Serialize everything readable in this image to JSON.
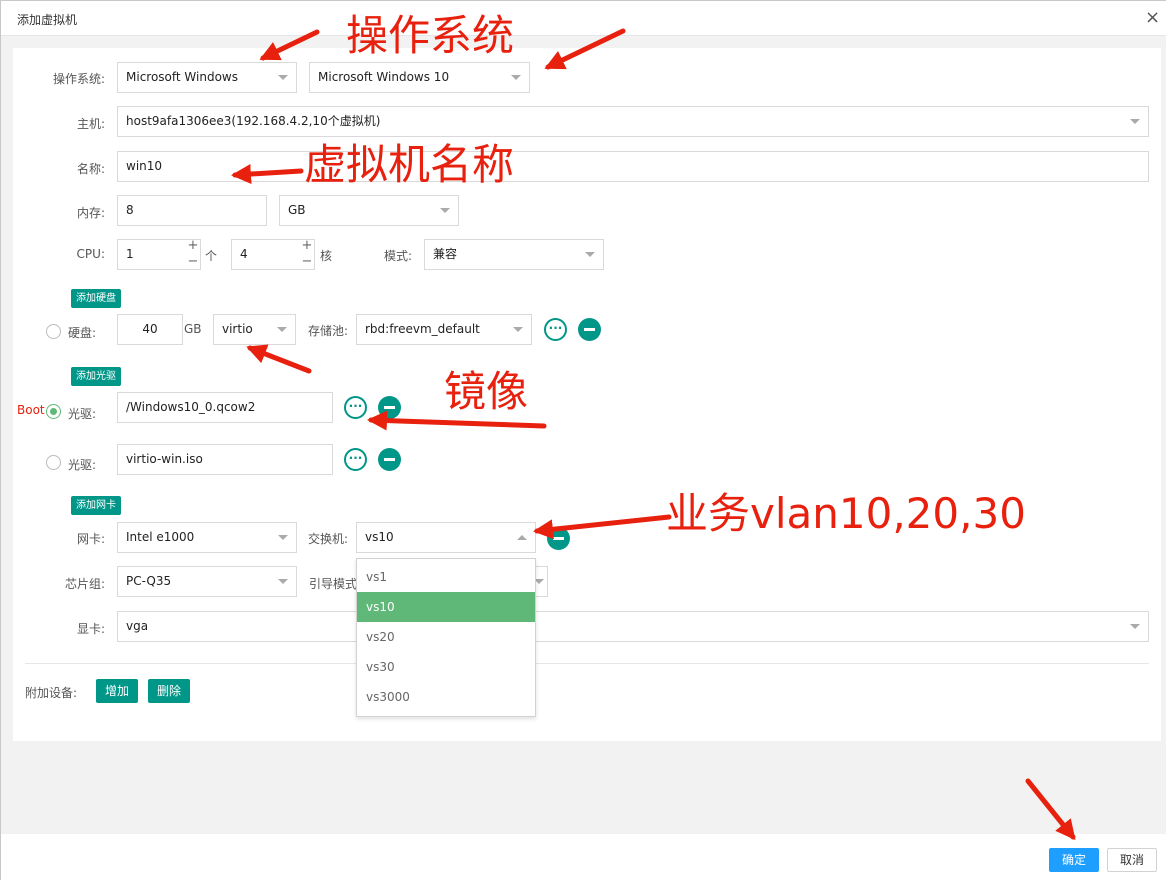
{
  "dialog": {
    "title": "添加虚拟机",
    "close_glyph": "×"
  },
  "form": {
    "os": {
      "label": "操作系统:",
      "family": "Microsoft Windows",
      "version": "Microsoft Windows 10"
    },
    "host": {
      "label": "主机:",
      "value": "host9afa1306ee3(192.168.4.2,10个虚拟机)"
    },
    "name": {
      "label": "名称:",
      "value": "win10"
    },
    "memory": {
      "label": "内存:",
      "value": "8",
      "unit": "GB"
    },
    "cpu": {
      "label": "CPU:",
      "sockets": "1",
      "sockets_unit": "个",
      "cores": "4",
      "cores_unit": "核",
      "mode_label": "模式:",
      "mode": "兼容"
    },
    "add_disk": "添加硬盘",
    "disk": {
      "label": "硬盘:",
      "size": "40",
      "unit": "GB",
      "bus": "virtio",
      "pool_label": "存储池:",
      "pool": "rbd:freevm_default"
    },
    "add_cdrom": "添加光驱",
    "boot_tag": "Boot",
    "cdroms": [
      {
        "label": "光驱:",
        "value": "/Windows10_0.qcow2",
        "boot": true
      },
      {
        "label": "光驱:",
        "value": "virtio-win.iso",
        "boot": false
      }
    ],
    "add_nic": "添加网卡",
    "nic": {
      "label": "网卡:",
      "model": "Intel e1000",
      "switch_label": "交换机:",
      "switch": "vs10"
    },
    "chipset": {
      "label": "芯片组:",
      "value": "PC-Q35",
      "boot_mode_label": "引导模式"
    },
    "gpu": {
      "label": "显卡:",
      "value": "vga"
    },
    "extra": {
      "label": "附加设备:",
      "add": "增加",
      "remove": "删除"
    }
  },
  "switch_dropdown": {
    "options": [
      "vs1",
      "vs10",
      "vs20",
      "vs30",
      "vs3000"
    ],
    "selected": "vs10"
  },
  "footer": {
    "ok": "确定",
    "cancel": "取消"
  },
  "annotations": {
    "os": "操作系统",
    "vm_name": "虚拟机名称",
    "image": "镜像",
    "vlan": "业务vlan10,20,30",
    "color": "#e8200e"
  },
  "colors": {
    "accent": "#009688",
    "selected": "#5fb878",
    "primary": "#1e9fff"
  }
}
